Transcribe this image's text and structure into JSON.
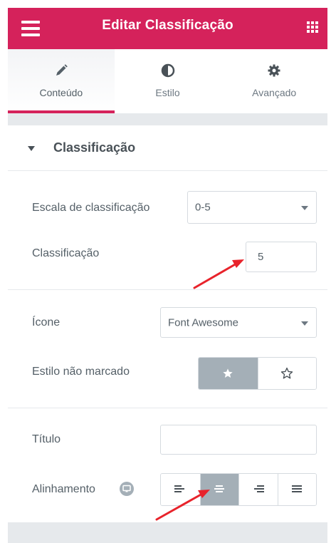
{
  "header": {
    "title": "Editar Classificação",
    "menu_icon": "hamburger-icon",
    "grid_icon": "apps-grid-icon",
    "background_color": "#d5225b"
  },
  "tabs": [
    {
      "label": "Conteúdo",
      "icon": "pencil-icon",
      "active": true
    },
    {
      "label": "Estilo",
      "icon": "half-circle-icon",
      "active": false
    },
    {
      "label": "Avançado",
      "icon": "gear-icon",
      "active": false
    }
  ],
  "section": {
    "title": "Classificação",
    "rating_scale": {
      "label": "Escala de classificação",
      "value": "0-5"
    },
    "rating": {
      "label": "Classificação",
      "value": "5"
    },
    "icon": {
      "label": "Ícone",
      "value": "Font Awesome"
    },
    "unmarked_style": {
      "label": "Estilo não marcado",
      "options": [
        {
          "icon": "star-solid-icon",
          "selected": true
        },
        {
          "icon": "star-outline-icon",
          "selected": false
        }
      ]
    },
    "title_field": {
      "label": "Título",
      "value": ""
    },
    "alignment": {
      "label": "Alinhamento",
      "help_icon": "responsive-help-icon",
      "options": [
        {
          "icon": "align-left-icon",
          "selected": false
        },
        {
          "icon": "align-center-icon",
          "selected": true
        },
        {
          "icon": "align-right-icon",
          "selected": false
        },
        {
          "icon": "align-justify-icon",
          "selected": false
        }
      ]
    }
  },
  "annotation_arrow_color": "#e8232b"
}
